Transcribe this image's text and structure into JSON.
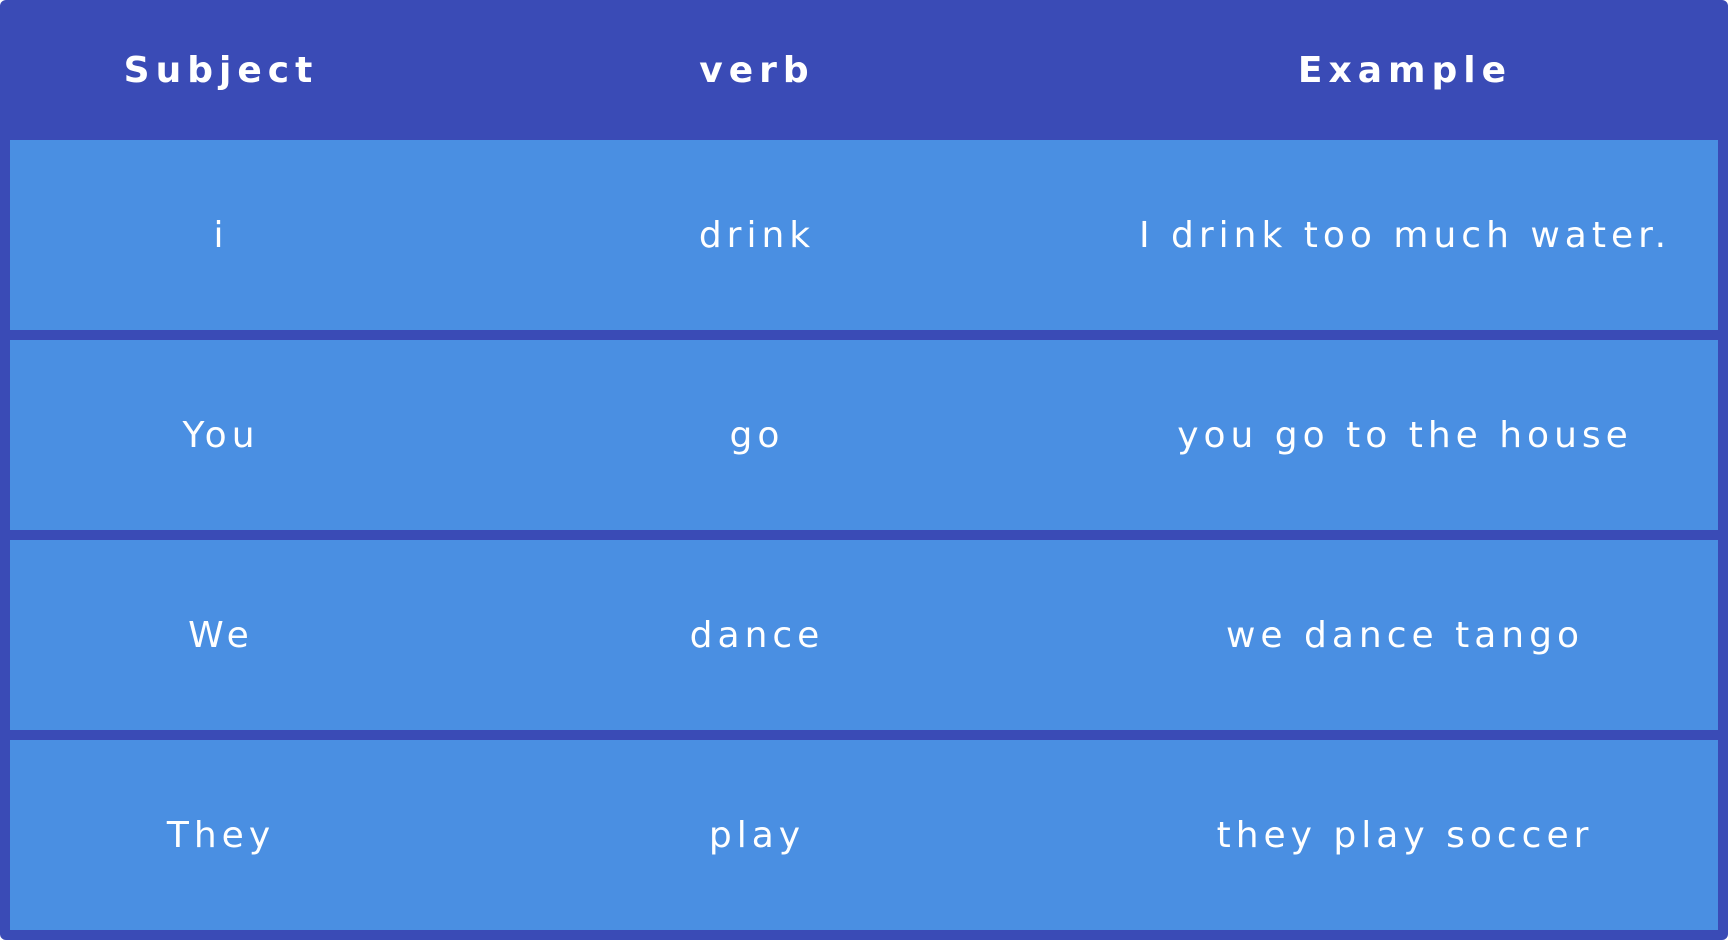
{
  "table": {
    "headers": [
      "Subject",
      "verb",
      "Example"
    ],
    "rows": [
      [
        "i",
        "drink",
        "I drink too much water."
      ],
      [
        "You",
        "go",
        "you go to the house"
      ],
      [
        "We",
        "dance",
        "we dance tango"
      ],
      [
        "They",
        "play",
        "they play soccer"
      ]
    ]
  },
  "colors": {
    "header_background": "#3a4bb6",
    "row_background": "#4a8fe2",
    "text": "#ffffff"
  }
}
